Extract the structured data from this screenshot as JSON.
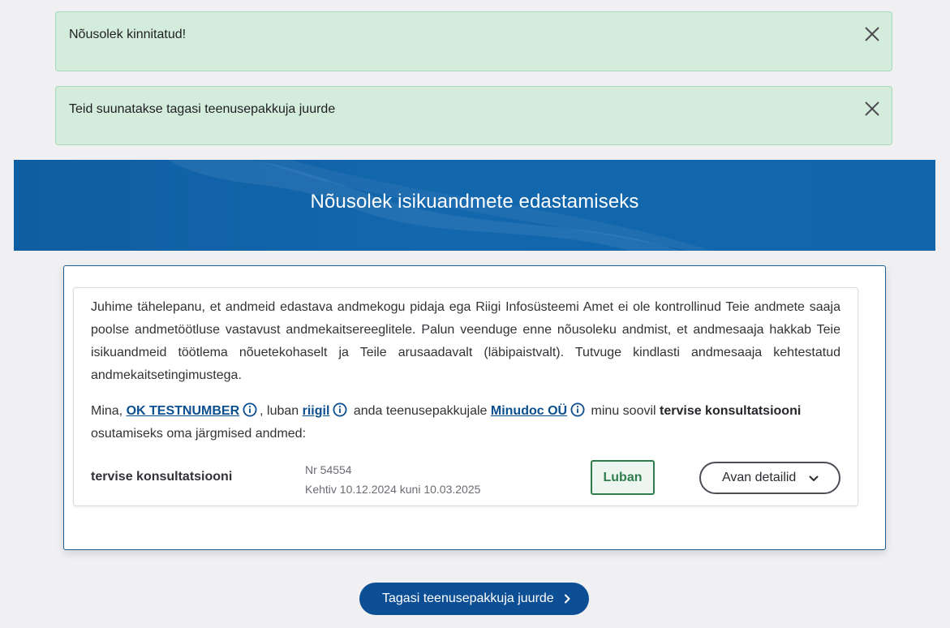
{
  "alerts": [
    {
      "text": "Nõusolek kinnitatud!",
      "close_icon": "close-icon"
    },
    {
      "text": "Teid suunatakse tagasi teenusepakkuja juurde",
      "close_icon": "close-icon"
    }
  ],
  "banner": {
    "title": "Nõusolek isikuandmete edastamiseks"
  },
  "notice": {
    "text": "Juhime tähelepanu, et andmeid edastava andmekogu pidaja ega Riigi Infosüsteemi Amet ei ole kontrollinud Teie andmete saaja poolse andmetöötluse vastavust andmekaitsereeglitele. Palun veenduge enne nõusoleku andmist, et andmesaaja hakkab Teie isikuandmeid töötlema nõuetekohaselt ja Teile arusaadavalt (läbipaistvalt). Tutvuge kindlasti andmesaaja kehtestatud andmekaitsetingimustega."
  },
  "consent": {
    "prefix": "Mina, ",
    "person": "OK TESTNUMBER",
    "part2": ", luban ",
    "giver": "riigil",
    "part3": " anda teenusepakkujale ",
    "provider": "Minudoc OÜ",
    "part4": " minu soovil ",
    "purpose": "tervise konsultatsiooni",
    "suffix": " osutamiseks oma järgmised andmed:"
  },
  "service": {
    "name": "tervise konsultatsiooni",
    "number": "Nr 54554",
    "validity": "Kehtiv 10.12.2024 kuni 10.03.2025",
    "approve_label": "Luban",
    "details_label": "Avan detailid"
  },
  "footer": {
    "back_label": "Tagasi teenusepakkuja juurde"
  },
  "colors": {
    "alert_bg": "#d4ecdc",
    "banner_bg": "#1166ab",
    "link": "#0c4f8f",
    "approve": "#2f7d4d",
    "primary_button": "#0c4f94"
  }
}
